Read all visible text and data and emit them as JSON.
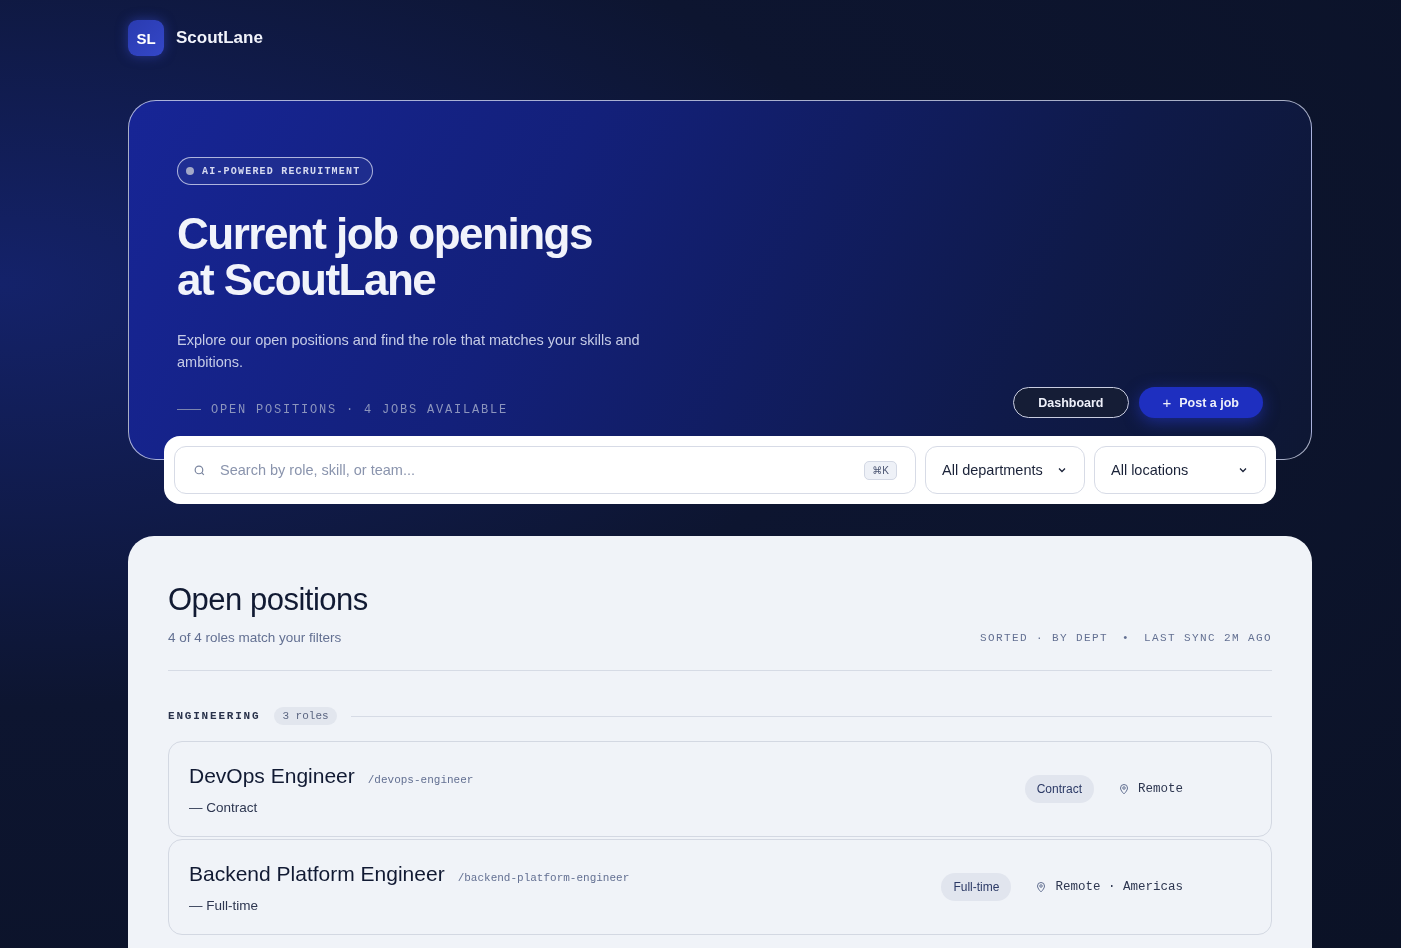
{
  "brand": {
    "logo": "SL",
    "name": "ScoutLane"
  },
  "hero": {
    "badge": "AI-POWERED RECRUITMENT",
    "title_lines": [
      "Current job openings",
      "at ScoutLane"
    ],
    "subtitle": "Explore our open positions and find the role that matches your skills and ambitions.",
    "meta": "OPEN POSITIONS · 4 JOBS AVAILABLE",
    "buttons": [
      {
        "kind": "outline",
        "label": "Dashboard"
      },
      {
        "kind": "primary",
        "label": "Post a job",
        "icon": "+"
      }
    ]
  },
  "filters": {
    "search": {
      "placeholder": "Search by role, skill, or team...",
      "shortcut": "⌘K"
    },
    "selects": [
      {
        "value": "All departments"
      },
      {
        "value": "All locations"
      }
    ]
  },
  "positions": {
    "title": "Open positions",
    "summary": "4 of 4 roles match your filters",
    "meta": [
      "SORTED · BY DEPT",
      "•",
      "LAST SYNC 2M AGO"
    ],
    "groups": [
      {
        "name": "ENGINEERING",
        "count": "3 roles",
        "jobs": [
          {
            "title": "DevOps Engineer",
            "slug": "/devops-engineer",
            "type_line": "— Contract",
            "tag": "Contract",
            "location": "Remote"
          },
          {
            "title": "Backend Platform Engineer",
            "slug": "/backend-platform-engineer",
            "type_line": "— Full-time",
            "tag": "Full-time",
            "location": "Remote · Americas"
          }
        ]
      }
    ]
  }
}
